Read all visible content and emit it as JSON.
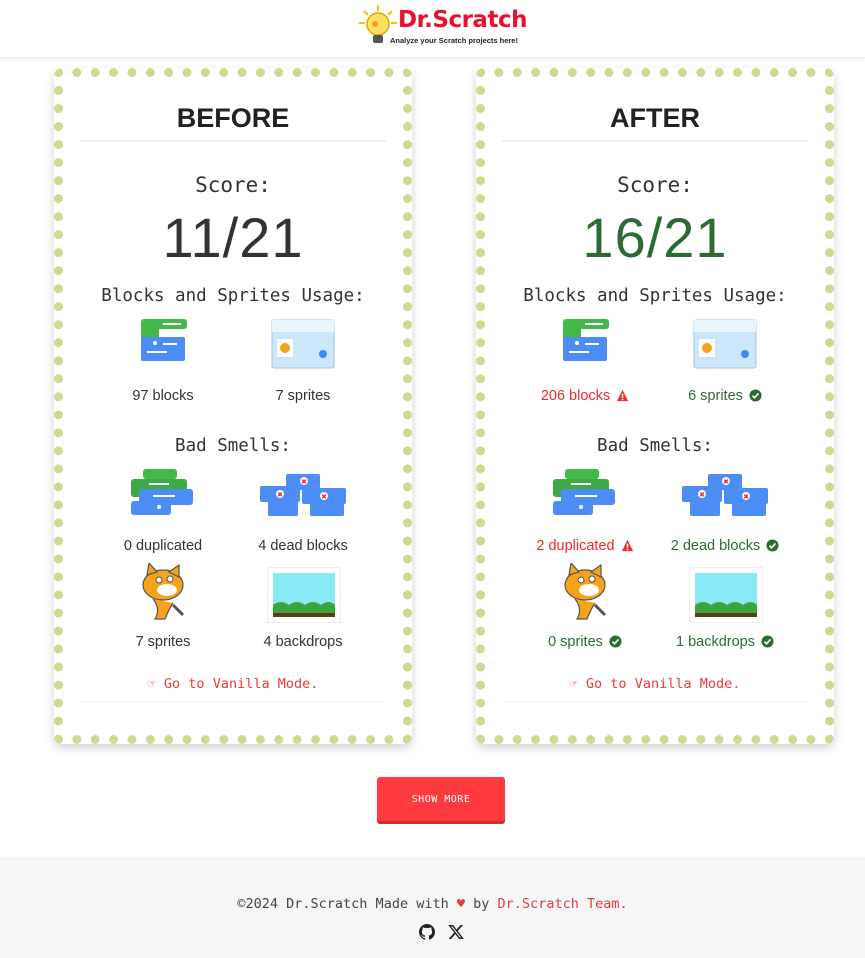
{
  "header": {
    "logo_title": "Dr.Scratch",
    "logo_subtitle": "Analyze your Scratch projects here!"
  },
  "before": {
    "title": "BEFORE",
    "score_label": "Score:",
    "score": "11/21",
    "usage_label": "Blocks and Sprites Usage:",
    "blocks": "97 blocks",
    "sprites": "7 sprites",
    "smells_label": "Bad Smells:",
    "duplicated": "0 duplicated",
    "dead_blocks": "4 dead blocks",
    "unused_sprites": "7 sprites",
    "backdrops": "4 backdrops",
    "vanilla_link": "Go to Vanilla Mode."
  },
  "after": {
    "title": "AFTER",
    "score_label": "Score:",
    "score": "16/21",
    "usage_label": "Blocks and Sprites Usage:",
    "blocks": "206 blocks",
    "sprites": "6 sprites",
    "smells_label": "Bad Smells:",
    "duplicated": "2 duplicated",
    "dead_blocks": "2 dead blocks",
    "unused_sprites": "0 sprites",
    "backdrops": "1 backdrops",
    "vanilla_link": "Go to Vanilla Mode."
  },
  "show_more_label": "SHOW MORE",
  "footer": {
    "copyright": "©2024 Dr.Scratch Made with",
    "heart": "♥",
    "by": "by",
    "team": "Dr.Scratch Team."
  },
  "icons": {
    "warning": "warning-icon",
    "check": "check-circle-icon",
    "hand": "hand-pointing-right-icon",
    "github": "github-icon",
    "x": "x-icon"
  },
  "colors": {
    "accent_red": "#ff3b3f",
    "good_green": "#2e6b34",
    "warn_red": "#ee2b2b",
    "border_dots": "#c9dc8f"
  }
}
